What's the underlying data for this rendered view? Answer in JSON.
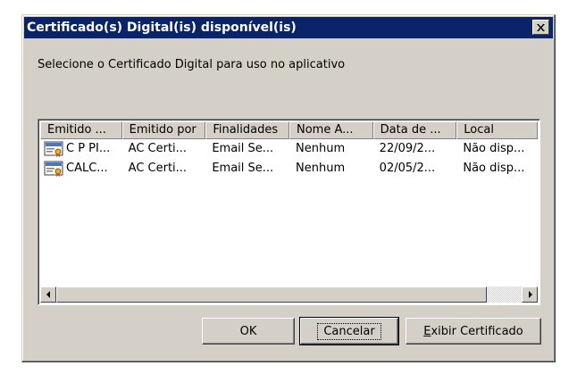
{
  "window": {
    "title": "Certificado(s) Digital(is) disponível(is)"
  },
  "prompt": "Selecione o Certificado Digital para uso no aplicativo",
  "table": {
    "columns": [
      "Emitido ...",
      "Emitido por",
      "Finalidades",
      "Nome A...",
      "Data de ...",
      "Local"
    ],
    "rows": [
      [
        "C P PI...",
        "AC Certi...",
        "Email Se...",
        "Nenhum",
        "22/09/2...",
        "Não disp..."
      ],
      [
        "CALC...",
        "AC Certi...",
        "Email Se...",
        "Nenhum",
        "02/05/2...",
        "Não disp..."
      ]
    ],
    "icon": "certificate-icon"
  },
  "buttons": {
    "ok": "OK",
    "cancel": "Cancelar",
    "view_prefix": "E",
    "view_rest": "xibir Certificado"
  },
  "colors": {
    "titlebar": "#0a246a",
    "face": "#d4d0c8"
  }
}
